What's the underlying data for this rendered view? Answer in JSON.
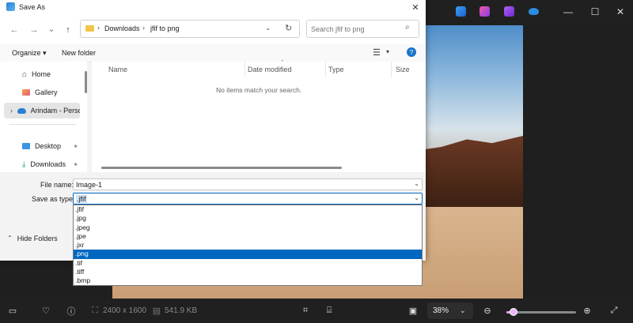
{
  "dialog": {
    "title": "Save As",
    "close_glyph": "✕",
    "nav": {
      "back_glyph": "←",
      "forward_glyph": "→",
      "recent_glyph": "⌄",
      "up_glyph": "↑"
    },
    "breadcrumb": [
      "Downloads",
      "jfif to png"
    ],
    "breadcrumb_sep": "›",
    "search_placeholder": "Search jfif to png",
    "toolbar": {
      "organize": "Organize ▾",
      "new_folder": "New folder"
    },
    "sidebar": [
      {
        "label": "Home",
        "icon": "home-icon"
      },
      {
        "label": "Gallery",
        "icon": "gallery-icon"
      },
      {
        "label": "Arindam - Perso",
        "icon": "onedrive-icon",
        "selected": true
      },
      {
        "label": "Desktop",
        "icon": "desktop-icon"
      },
      {
        "label": "Downloads",
        "icon": "download-icon"
      }
    ],
    "columns": [
      "Name",
      "Date modified",
      "Type",
      "Size"
    ],
    "empty_message": "No items match your search.",
    "file_name_label": "File name:",
    "file_name_value": "Image-1",
    "save_type_label": "Save as type:",
    "save_type_value": ".jfif",
    "type_options": [
      ".jfif",
      ".jpg",
      ".jpeg",
      ".jpe",
      ".jxr",
      ".png",
      ".tif",
      ".tiff",
      ".bmp"
    ],
    "selected_option": ".png",
    "hide_folders": "Hide Folders"
  },
  "photos_app": {
    "window_controls": {
      "minimize": "—",
      "maximize": "☐",
      "close": "✕"
    },
    "bottom_bar": {
      "dimensions": "2400 x 1600",
      "file_size": "541.9 KB",
      "zoom_value": "38%",
      "zoom_fraction": 0.1
    }
  },
  "colors": {
    "accent": "#0067c0",
    "zoom_accent": "#e0a6f0"
  }
}
